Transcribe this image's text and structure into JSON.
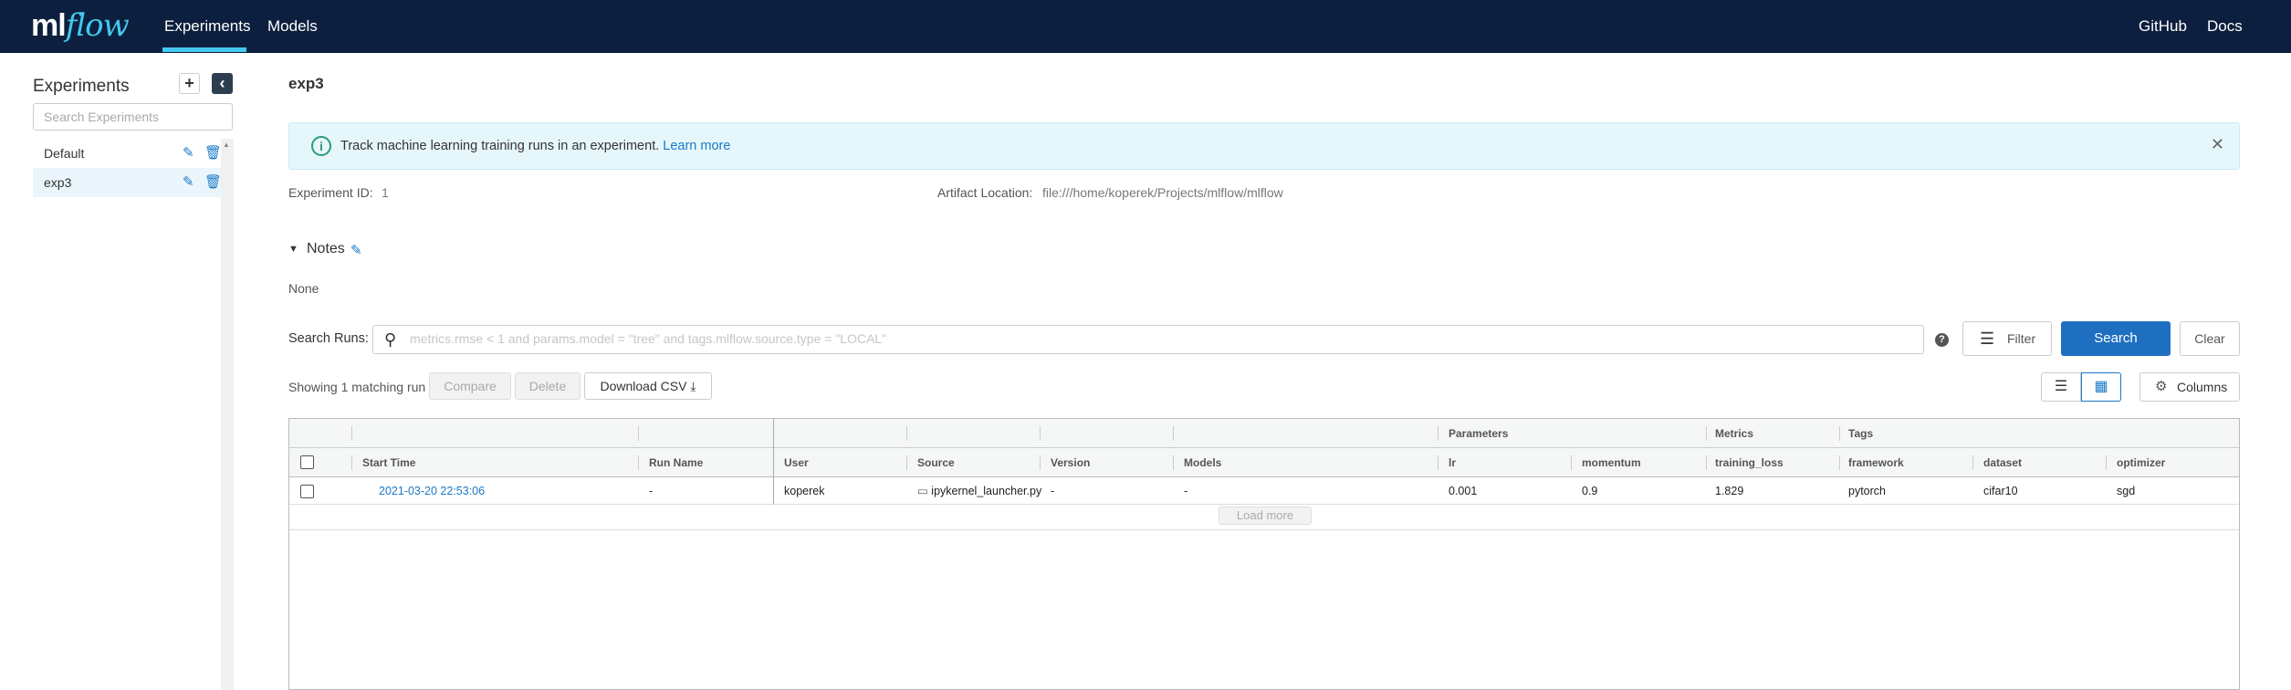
{
  "header": {
    "logo_ml": "ml",
    "logo_flow": "flow",
    "nav": [
      "Experiments",
      "Models"
    ],
    "right_links": [
      "GitHub",
      "Docs"
    ]
  },
  "sidebar": {
    "title": "Experiments",
    "add_icon": "plus-icon",
    "collapse_icon": "chevron-left-icon",
    "search_placeholder": "Search Experiments",
    "items": [
      {
        "label": "Default",
        "active": false
      },
      {
        "label": "exp3",
        "active": true
      }
    ]
  },
  "main": {
    "title": "exp3",
    "banner": {
      "text": "Track machine learning training runs in an experiment.",
      "link": "Learn more"
    },
    "experiment_id_label": "Experiment ID:",
    "experiment_id": "1",
    "artifact_label": "Artifact Location:",
    "artifact_location": "file:///home/koperek/Projects/mlflow/mlflow",
    "notes_label": "Notes",
    "notes_body": "None",
    "search": {
      "label": "Search Runs:",
      "placeholder": "metrics.rmse < 1 and params.model = \"tree\" and tags.mlflow.source.type = \"LOCAL\"",
      "filter": "Filter",
      "search": "Search",
      "clear": "Clear"
    },
    "toolbar": {
      "showing": "Showing 1 matching run",
      "compare": "Compare",
      "delete": "Delete",
      "download": "Download CSV",
      "columns": "Columns"
    },
    "table": {
      "groups": {
        "parameters": "Parameters",
        "metrics": "Metrics",
        "tags": "Tags"
      },
      "headers": [
        "Start Time",
        "Run Name",
        "User",
        "Source",
        "Version",
        "Models",
        "lr",
        "momentum",
        "training_loss",
        "framework",
        "dataset",
        "optimizer"
      ],
      "row": {
        "start_time": "2021-03-20 22:53:06",
        "run_name": "-",
        "user": "koperek",
        "source": "ipykernel_launcher.py",
        "version": "-",
        "models": "-",
        "lr": "0.001",
        "momentum": "0.9",
        "training_loss": "1.829",
        "framework": "pytorch",
        "dataset": "cifar10",
        "optimizer": "sgd"
      },
      "load_more": "Load more"
    }
  },
  "colors": {
    "header_bg": "#0d1f3e",
    "accent": "#43c9ed",
    "primary": "#1f6fc1",
    "link": "#1a79c7"
  }
}
